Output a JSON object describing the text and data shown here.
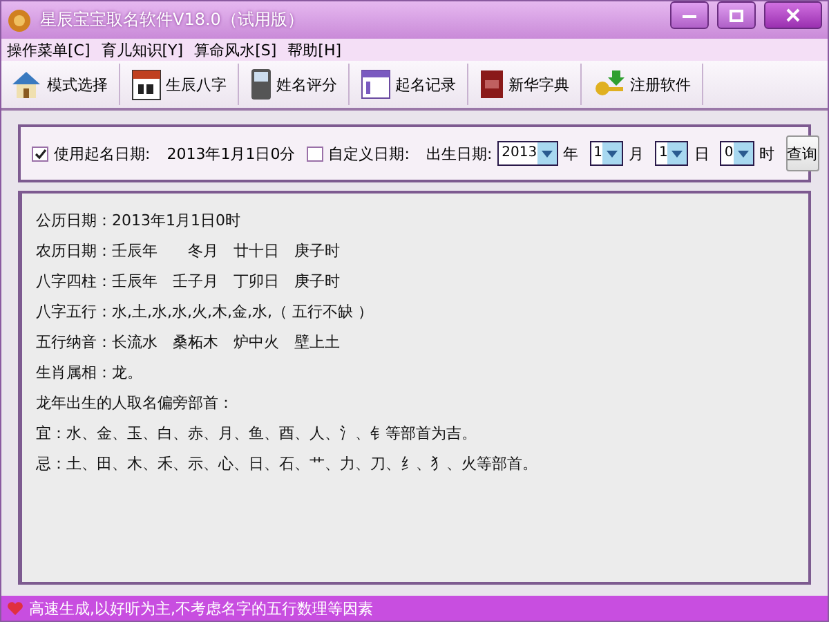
{
  "window": {
    "title": "星辰宝宝取名软件V18.0（试用版）"
  },
  "menu": [
    "操作菜单[C]",
    "育儿知识[Y]",
    "算命风水[S]",
    "帮助[H]"
  ],
  "toolbar": [
    {
      "kind": "house",
      "label": "模式选择"
    },
    {
      "kind": "calendar",
      "label": "生辰八字"
    },
    {
      "kind": "phone",
      "label": "姓名评分"
    },
    {
      "kind": "record",
      "label": "起名记录"
    },
    {
      "kind": "book",
      "label": "新华字典"
    },
    {
      "kind": "key",
      "label": "注册软件"
    }
  ],
  "options": {
    "use_date": {
      "checked": true,
      "label": "使用起名日期:",
      "value": "2013年1月1日0分"
    },
    "custom_date": {
      "checked": false,
      "label": "自定义日期:"
    },
    "birth_label": "出生日期:",
    "fields": [
      {
        "value": "2013",
        "unit": "年"
      },
      {
        "value": "1",
        "unit": "月"
      },
      {
        "value": "1",
        "unit": "日"
      },
      {
        "value": "0",
        "unit": "时"
      }
    ],
    "query_button": "查询"
  },
  "result_lines": [
    "公历日期：2013年1月1日0时",
    "农历日期：壬辰年　　冬月　廿十日　庚子时",
    "八字四柱：壬辰年　壬子月　丁卯日　庚子时",
    "八字五行：水,土,水,水,火,木,金,水,（ 五行不缺 ）",
    "五行纳音：长流水　桑柘木　炉中火　壁上土",
    "生肖属相：龙。",
    "龙年出生的人取名偏旁部首：",
    "宜：水、金、玉、白、赤、月、鱼、酉、人、氵、钅等部首为吉。",
    "忌：土、田、木、禾、示、心、日、石、艹、力、刀、纟、犭、火等部首。"
  ],
  "status_bar": "高速生成,以好听为主,不考虑名字的五行数理等因素"
}
